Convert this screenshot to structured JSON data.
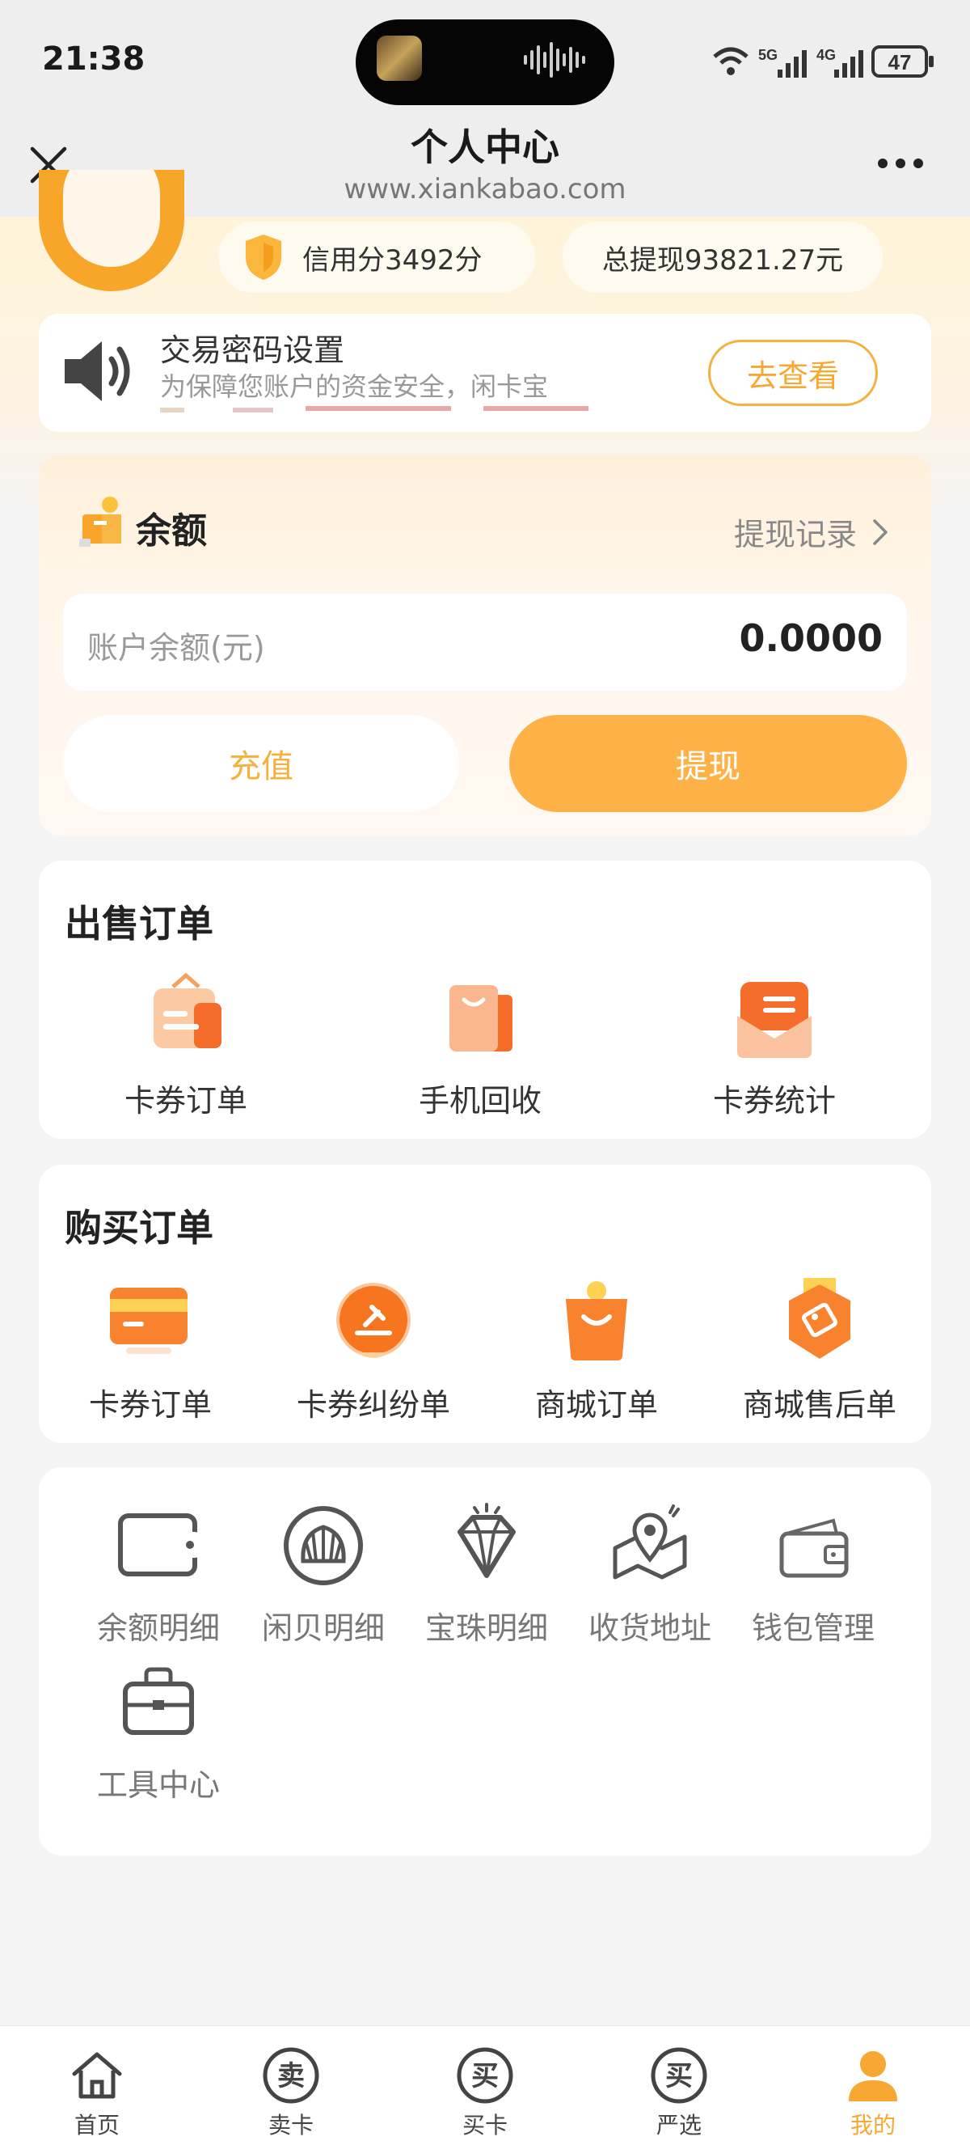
{
  "status_bar": {
    "time": "21:38",
    "network_1": "5G",
    "network_2": "4G",
    "battery": "47"
  },
  "header": {
    "title": "个人中心",
    "url": "www.xiankabao.com"
  },
  "profile": {
    "credit_label": "信用分3492分",
    "withdraw_total": "总提现93821.27元"
  },
  "notice": {
    "title": "交易密码设置",
    "subtitle": "为保障您账户的资金安全，闲卡宝",
    "button": "去查看"
  },
  "balance": {
    "title": "余额",
    "record_link": "提现记录",
    "label": "账户余额(元)",
    "value": "0.0000",
    "recharge": "充值",
    "withdraw": "提现"
  },
  "sell_orders": {
    "title": "出售订单",
    "items": [
      {
        "label": "卡券订单",
        "icon": "coupon-order-icon"
      },
      {
        "label": "手机回收",
        "icon": "phone-recycle-icon"
      },
      {
        "label": "卡券统计",
        "icon": "coupon-stats-icon"
      }
    ]
  },
  "buy_orders": {
    "title": "购买订单",
    "items": [
      {
        "label": "卡券订单",
        "icon": "card-icon"
      },
      {
        "label": "卡券纠纷单",
        "icon": "dispute-icon"
      },
      {
        "label": "商城订单",
        "icon": "shopping-bag-icon"
      },
      {
        "label": "商城售后单",
        "icon": "after-sale-icon"
      }
    ]
  },
  "tools": {
    "items": [
      {
        "label": "余额明细",
        "icon": "wallet-card-icon"
      },
      {
        "label": "闲贝明细",
        "icon": "shell-icon"
      },
      {
        "label": "宝珠明细",
        "icon": "diamond-icon"
      },
      {
        "label": "收货地址",
        "icon": "address-icon"
      },
      {
        "label": "钱包管理",
        "icon": "wallet-icon"
      },
      {
        "label": "工具中心",
        "icon": "toolbox-icon"
      }
    ]
  },
  "bottom_nav": {
    "items": [
      {
        "label": "首页",
        "glyph": ""
      },
      {
        "label": "卖卡",
        "glyph": "卖"
      },
      {
        "label": "买卡",
        "glyph": "买"
      },
      {
        "label": "严选",
        "glyph": "买"
      },
      {
        "label": "我的",
        "glyph": ""
      }
    ],
    "active_color": "#f6a832"
  },
  "colors": {
    "accent": "#fdb146",
    "accent_text": "#f6a832",
    "page_bg": "#f4f4f5"
  }
}
